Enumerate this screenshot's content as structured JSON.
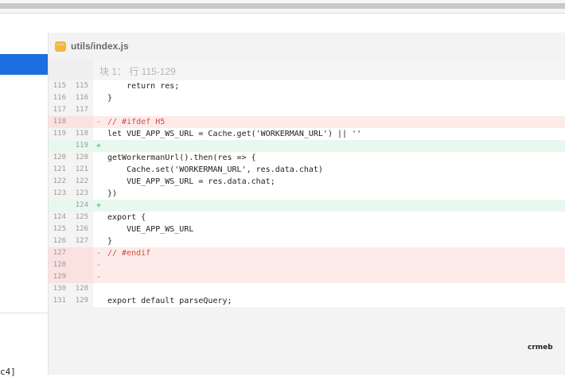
{
  "file": {
    "name": "utils/index.js",
    "icon": "ellipsis-file-icon"
  },
  "hunk": {
    "label": "块 1： 行 115-129"
  },
  "sidebar": {
    "partial_text": "c4]"
  },
  "brand": {
    "text": "crmeb"
  },
  "colors": {
    "selection": "#1d6fe0",
    "deleted_bg": "#fdebea",
    "added_bg": "#e8f8ef",
    "deleted_text": "#d24c42",
    "file_icon": "#f5b83c"
  },
  "diff_lines": [
    {
      "type": "ctx",
      "old": "115",
      "new": "115",
      "sign": "",
      "text": "    return res;"
    },
    {
      "type": "ctx",
      "old": "116",
      "new": "116",
      "sign": "",
      "text": "}"
    },
    {
      "type": "ctx",
      "old": "117",
      "new": "117",
      "sign": "",
      "text": ""
    },
    {
      "type": "del",
      "old": "118",
      "new": "",
      "sign": "-",
      "text": "// #ifdef H5"
    },
    {
      "type": "ctx",
      "old": "119",
      "new": "118",
      "sign": "",
      "text": "let VUE_APP_WS_URL = Cache.get('WORKERMAN_URL') || ''"
    },
    {
      "type": "add",
      "old": "",
      "new": "119",
      "sign": "+",
      "text": ""
    },
    {
      "type": "ctx",
      "old": "120",
      "new": "120",
      "sign": "",
      "text": "getWorkermanUrl().then(res => {"
    },
    {
      "type": "ctx",
      "old": "121",
      "new": "121",
      "sign": "",
      "text": "    Cache.set('WORKERMAN_URL', res.data.chat)"
    },
    {
      "type": "ctx",
      "old": "122",
      "new": "122",
      "sign": "",
      "text": "    VUE_APP_WS_URL = res.data.chat;"
    },
    {
      "type": "ctx",
      "old": "123",
      "new": "123",
      "sign": "",
      "text": "})"
    },
    {
      "type": "add",
      "old": "",
      "new": "124",
      "sign": "+",
      "text": ""
    },
    {
      "type": "ctx",
      "old": "124",
      "new": "125",
      "sign": "",
      "text": "export {"
    },
    {
      "type": "ctx",
      "old": "125",
      "new": "126",
      "sign": "",
      "text": "    VUE_APP_WS_URL"
    },
    {
      "type": "ctx",
      "old": "126",
      "new": "127",
      "sign": "",
      "text": "}"
    },
    {
      "type": "del",
      "old": "127",
      "new": "",
      "sign": "-",
      "text": "// #endif"
    },
    {
      "type": "del",
      "old": "128",
      "new": "",
      "sign": "-",
      "text": ""
    },
    {
      "type": "del",
      "old": "129",
      "new": "",
      "sign": "-",
      "text": ""
    },
    {
      "type": "ctx",
      "old": "130",
      "new": "128",
      "sign": "",
      "text": ""
    },
    {
      "type": "ctx",
      "old": "131",
      "new": "129",
      "sign": "",
      "text": "export default parseQuery;"
    }
  ]
}
